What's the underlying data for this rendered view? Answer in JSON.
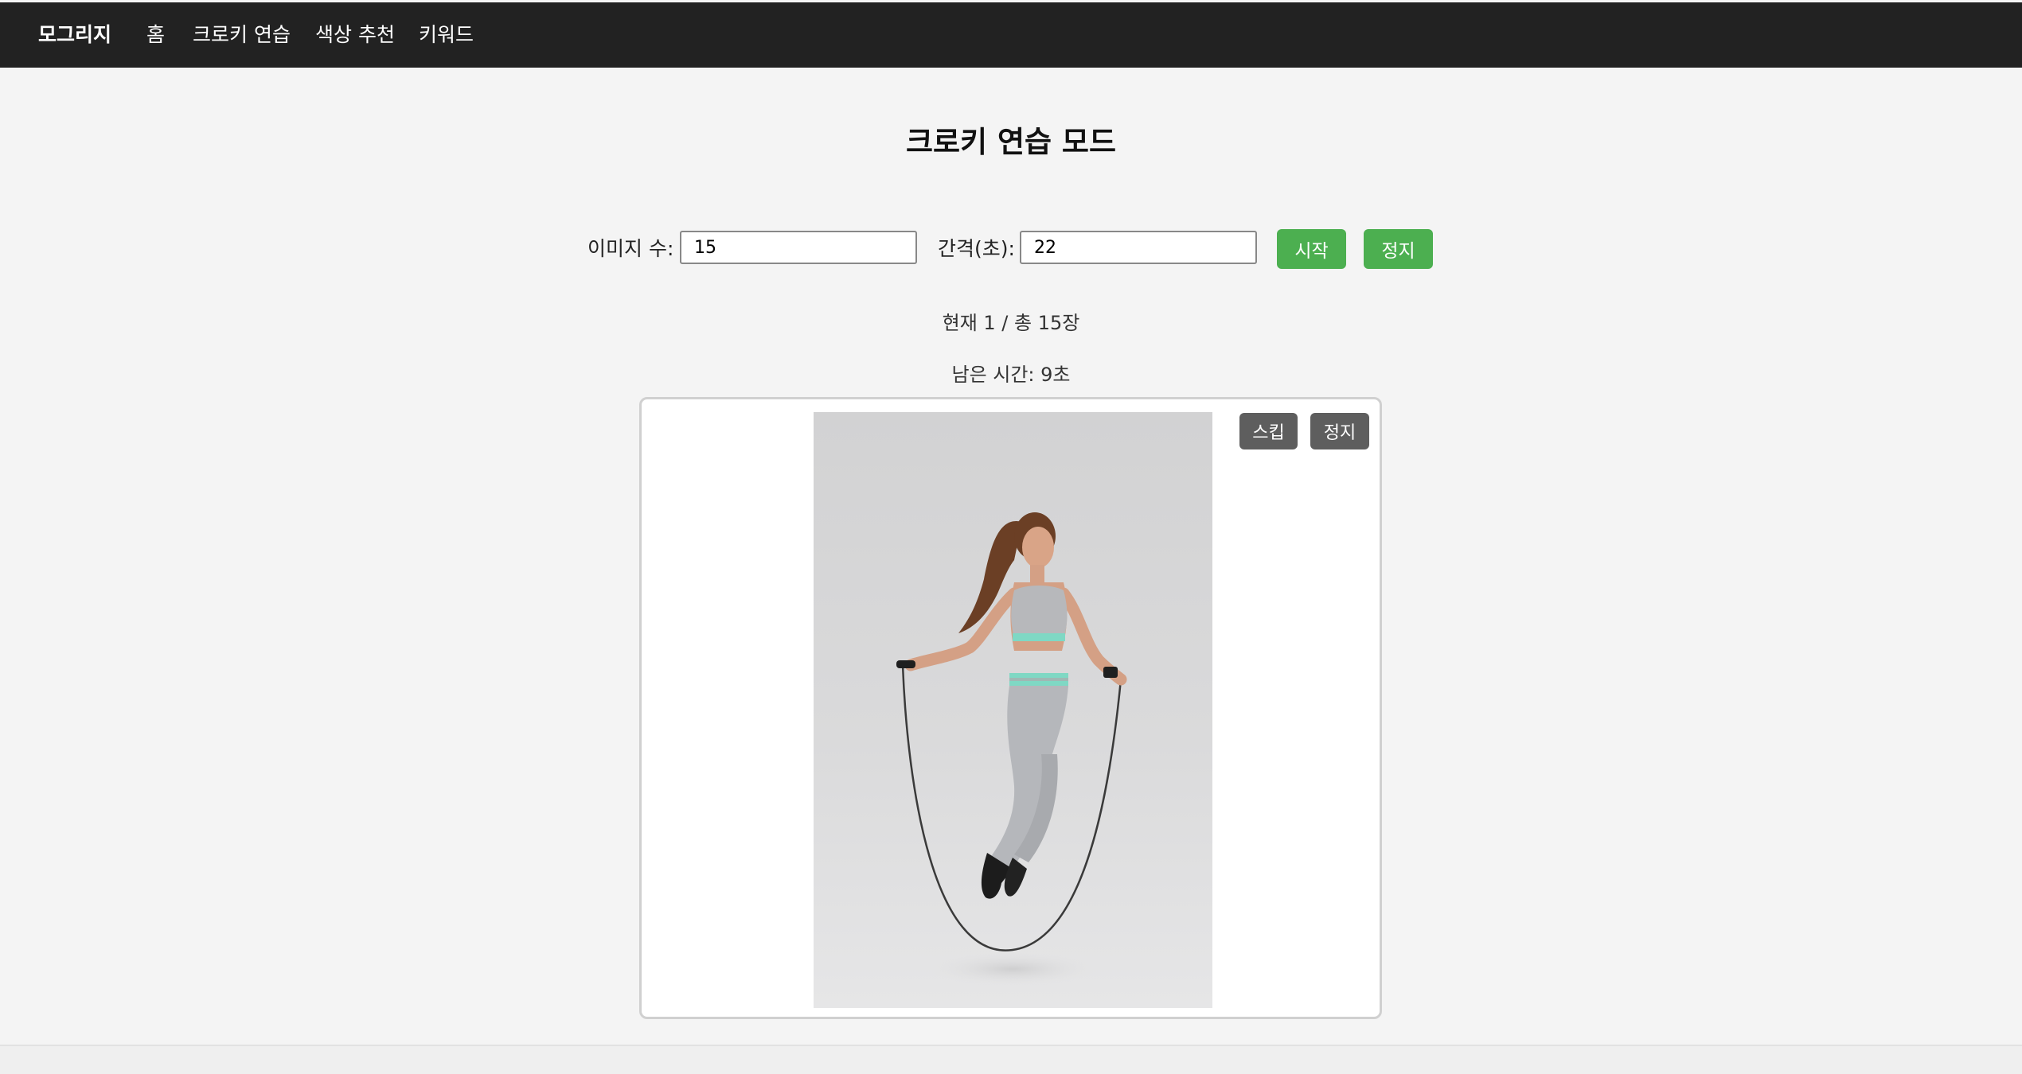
{
  "nav": {
    "brand": "모그리지",
    "items": [
      "홈",
      "크로키 연습",
      "색상 추천",
      "키워드"
    ]
  },
  "page": {
    "title": "크로키 연습 모드"
  },
  "controls": {
    "image_count_label": "이미지 수:",
    "image_count_value": "15",
    "interval_label": "간격(초):",
    "interval_value": "22",
    "start_label": "시작",
    "stop_label": "정지"
  },
  "status": {
    "progress_text": "현재 1 / 총 15장",
    "remaining_text": "남은 시간: 9초"
  },
  "viewer": {
    "skip_label": "스킵",
    "stop_label": "정지",
    "photo_subject": "woman jumping rope"
  },
  "colors": {
    "nav_bg": "#222222",
    "accent_green": "#4caf50",
    "viewer_button": "#5e5e5e",
    "page_bg": "#f4f4f4"
  }
}
